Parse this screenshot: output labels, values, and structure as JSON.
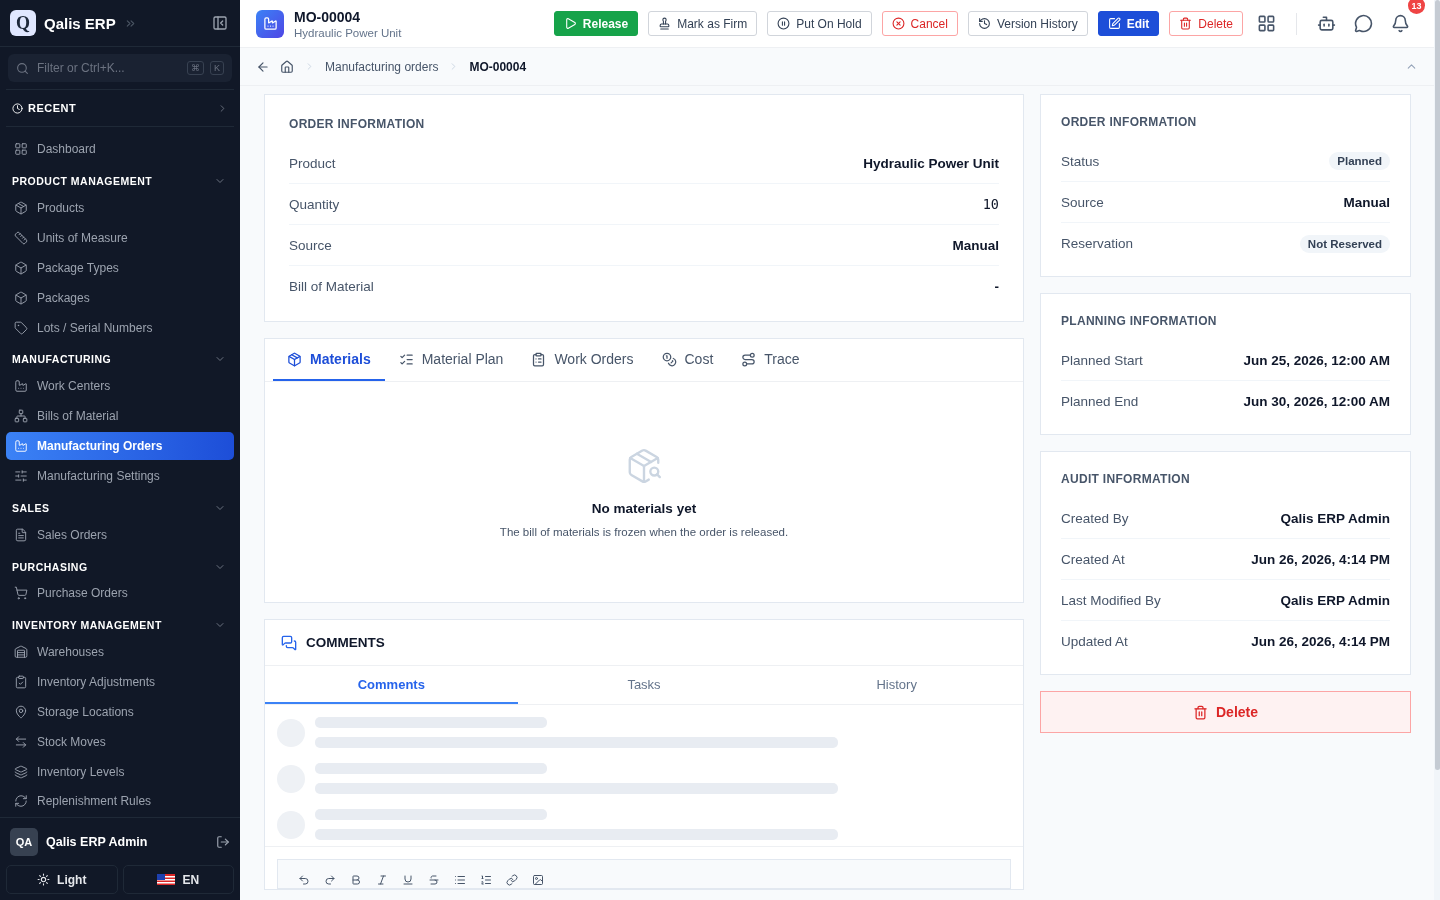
{
  "app": {
    "logo_letter": "Q",
    "name": "Qalis ERP",
    "search_placeholder": "Filter or Ctrl+K...",
    "shortcut_keys": [
      "⌘",
      "K"
    ]
  },
  "sidebar": {
    "recent": {
      "label": "RECENT",
      "expanded": false
    },
    "groups": [
      {
        "items": [
          {
            "label": "Dashboard",
            "selected": false
          }
        ]
      },
      {
        "title": "PRODUCT MANAGEMENT",
        "expanded": true,
        "items": [
          {
            "label": "Products",
            "selected": false
          },
          {
            "label": "Units of Measure",
            "selected": false
          },
          {
            "label": "Package Types",
            "selected": false
          },
          {
            "label": "Packages",
            "selected": false
          },
          {
            "label": "Lots / Serial Numbers",
            "selected": false
          }
        ]
      },
      {
        "title": "MANUFACTURING",
        "expanded": true,
        "items": [
          {
            "label": "Work Centers",
            "selected": false
          },
          {
            "label": "Bills of Material",
            "selected": false
          },
          {
            "label": "Manufacturing Orders",
            "selected": true
          },
          {
            "label": "Manufacturing Settings",
            "selected": false
          }
        ]
      },
      {
        "title": "SALES",
        "expanded": true,
        "items": [
          {
            "label": "Sales Orders",
            "selected": false
          }
        ]
      },
      {
        "title": "PURCHASING",
        "expanded": true,
        "items": [
          {
            "label": "Purchase Orders",
            "selected": false
          }
        ]
      },
      {
        "title": "INVENTORY MANAGEMENT",
        "expanded": true,
        "items": [
          {
            "label": "Warehouses",
            "selected": false
          },
          {
            "label": "Inventory Adjustments",
            "selected": false
          },
          {
            "label": "Storage Locations",
            "selected": false
          },
          {
            "label": "Stock Moves",
            "selected": false
          },
          {
            "label": "Inventory Levels",
            "selected": false
          },
          {
            "label": "Replenishment Rules",
            "selected": false
          }
        ]
      }
    ],
    "user": {
      "initials": "QA",
      "name": "Qalis ERP Admin"
    },
    "theme_button": "Light",
    "language_button": "EN"
  },
  "header": {
    "title": "MO-00004",
    "subtitle": "Hydraulic Power Unit",
    "actions": [
      {
        "label": "Release",
        "kind": "success"
      },
      {
        "label": "Mark as Firm",
        "kind": "outline"
      },
      {
        "label": "Put On Hold",
        "kind": "outline"
      },
      {
        "label": "Cancel",
        "kind": "danger"
      },
      {
        "label": "Version History",
        "kind": "outline"
      },
      {
        "label": "Edit",
        "kind": "primary"
      },
      {
        "label": "Delete",
        "kind": "danger"
      }
    ],
    "notification_count": "13"
  },
  "breadcrumb": [
    "Manufacturing orders",
    "MO-00004"
  ],
  "order_card": {
    "title": "ORDER INFORMATION",
    "rows": [
      {
        "label": "Product",
        "value": "Hydraulic Power Unit",
        "kind": "text"
      },
      {
        "label": "Quantity",
        "value": "10",
        "kind": "mono"
      },
      {
        "label": "Source",
        "value": "Manual",
        "kind": "text"
      },
      {
        "label": "Bill of Material",
        "value": "-",
        "kind": "text"
      }
    ]
  },
  "detail_tabs": [
    {
      "label": "Materials",
      "selected": true
    },
    {
      "label": "Material Plan",
      "selected": false
    },
    {
      "label": "Work Orders",
      "selected": false
    },
    {
      "label": "Cost",
      "selected": false
    },
    {
      "label": "Trace",
      "selected": false
    }
  ],
  "empty_state": {
    "title": "No materials yet",
    "text": "The bill of materials is frozen when the order is released."
  },
  "comments": {
    "title": "COMMENTS",
    "tabs": [
      {
        "label": "Comments",
        "selected": true
      },
      {
        "label": "Tasks",
        "selected": false
      },
      {
        "label": "History",
        "selected": false
      }
    ]
  },
  "side_cards": [
    {
      "title": "ORDER INFORMATION",
      "rows": [
        {
          "label": "Status",
          "value": "Planned",
          "kind": "badge"
        },
        {
          "label": "Source",
          "value": "Manual",
          "kind": "text"
        },
        {
          "label": "Reservation",
          "value": "Not Reserved",
          "kind": "badge"
        }
      ]
    },
    {
      "title": "PLANNING INFORMATION",
      "rows": [
        {
          "label": "Planned Start",
          "value": "Jun 25, 2026, 12:00 AM",
          "kind": "text"
        },
        {
          "label": "Planned End",
          "value": "Jun 30, 2026, 12:00 AM",
          "kind": "text"
        }
      ]
    },
    {
      "title": "AUDIT INFORMATION",
      "rows": [
        {
          "label": "Created By",
          "value": "Qalis ERP Admin",
          "kind": "text"
        },
        {
          "label": "Created At",
          "value": "Jun 26, 2026, 4:14 PM",
          "kind": "text"
        },
        {
          "label": "Last Modified By",
          "value": "Qalis ERP Admin",
          "kind": "text"
        },
        {
          "label": "Updated At",
          "value": "Jun 26, 2026, 4:14 PM",
          "kind": "text"
        }
      ]
    }
  ],
  "delete_button": "Delete"
}
